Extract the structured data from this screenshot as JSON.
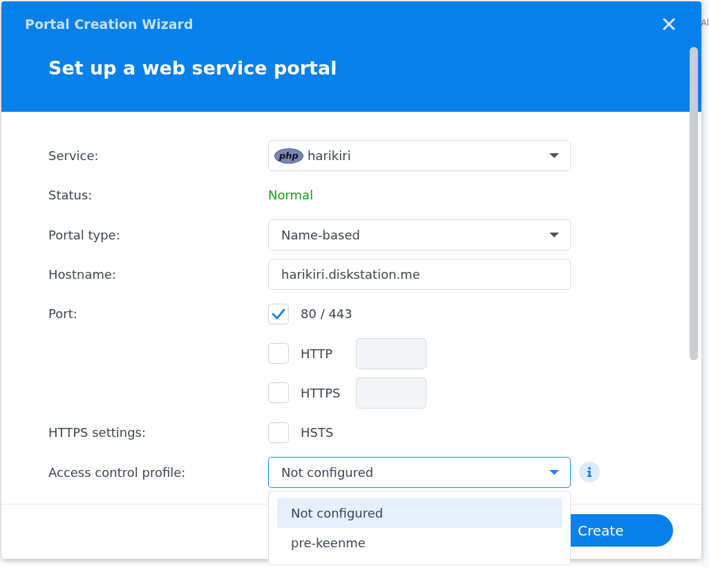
{
  "dialog": {
    "title": "Portal Creation Wizard",
    "heading": "Set up a web service portal"
  },
  "fields": [
    {
      "kind": "select",
      "label": "Service:",
      "value": "harikiri",
      "logo_text": "php",
      "focused": false
    },
    {
      "kind": "status",
      "label": "Status:",
      "value": "Normal"
    },
    {
      "kind": "select",
      "label": "Portal type:",
      "value": "Name-based",
      "focused": false
    },
    {
      "kind": "text",
      "label": "Hostname:",
      "value": "harikiri.diskstation.me"
    },
    {
      "kind": "check",
      "label": "Port:",
      "text": "80 / 443",
      "checked": true
    },
    {
      "kind": "check_port",
      "text": "HTTP",
      "checked": false
    },
    {
      "kind": "check_port",
      "text": "HTTPS",
      "checked": false
    },
    {
      "kind": "check",
      "label": "HTTPS settings:",
      "text": "HSTS",
      "checked": false
    },
    {
      "kind": "select",
      "label": "Access control profile:",
      "value": "Not configured",
      "focused": true,
      "info": true
    }
  ],
  "dropdown": {
    "options": [
      {
        "label": "Not configured",
        "selected": true
      },
      {
        "label": "pre-keenme",
        "selected": false
      }
    ]
  },
  "buttons": [
    {
      "label": "Create"
    }
  ],
  "background_text": "Al"
}
